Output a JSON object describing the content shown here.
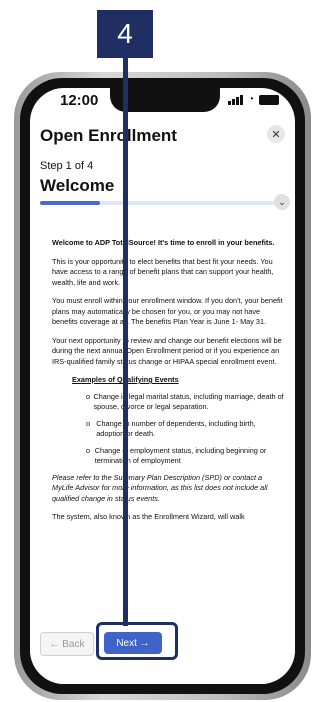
{
  "badge": {
    "number": "4"
  },
  "status_bar": {
    "time": "12:00"
  },
  "header": {
    "title": "Open Enrollment",
    "close_icon": "close-icon"
  },
  "wizard": {
    "step": "Step 1 of 4",
    "page_title": "Welcome",
    "progress_fraction": 0.25
  },
  "content": {
    "welcome": "Welcome to ADP TotalSource! It's time to enroll in your benefits.",
    "p1": "This is your opportunity to elect benefits that best fit your needs. You have access to a range of benefit plans that can support your health, wealth, life and work.",
    "p2": "You must enroll within your enrollment window. If you don't, your benefit plans may automatically be chosen for you, or you may not have benefits coverage at all. The benefits Plan Year is June 1- May 31.",
    "p3": "Your next opportunity to review and change our benefit elections will be during the next annual Open Enrollment period or if you experience an IRS-qualified family status change or HIPAA special enrollment event.",
    "examples_title": "Examples of Qualifying Events",
    "examples": [
      "Change in legal marital status, including marriage, death of spouse, divorce or legal separation.",
      "Change in number of dependents, including birth, adoption or death.",
      "Change in employment status, including beginning or termination of employment"
    ],
    "note": "Please refer to the Summary Plan Description (SPD) or contact a MyLife Advisor for more information, as this list does not include all qualified change in status events.",
    "p4": "The system, also known as the Enrollment Wizard, will walk"
  },
  "footer": {
    "back_label": "← Back",
    "next_label": "Next →"
  }
}
